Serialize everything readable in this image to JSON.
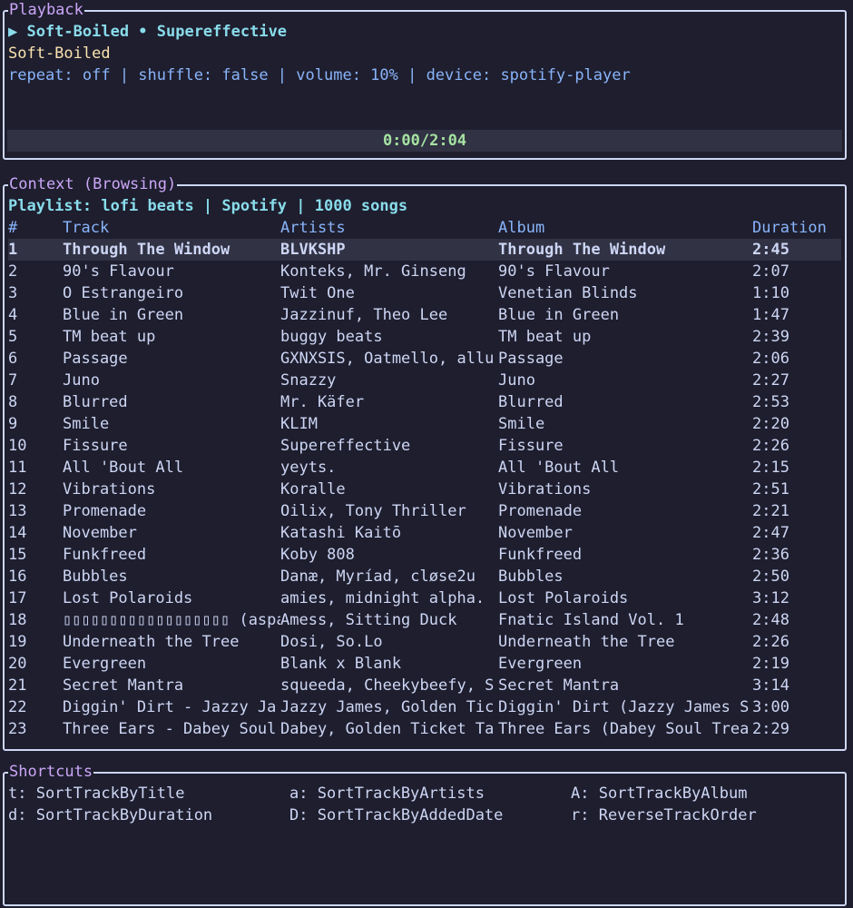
{
  "playback": {
    "title": "Playback",
    "now_playing": "▶ Soft-Boiled • Supereffective",
    "album": "Soft-Boiled",
    "status": "repeat: off | shuffle: false | volume: 10% | device: spotify-player",
    "progress_text": "0:00/2:04"
  },
  "context": {
    "title": "Context (Browsing)",
    "playlist_line": "Playlist: lofi beats | Spotify | 1000 songs",
    "columns": [
      "#",
      "Track",
      "Artists",
      "Album",
      "Duration"
    ],
    "selected_index": 0,
    "rows": [
      [
        "1",
        "Through The Window",
        "BLVKSHP",
        "Through The Window",
        "2:45"
      ],
      [
        "2",
        "90's Flavour",
        "Konteks, Mr. Ginseng",
        "90's Flavour",
        "2:07"
      ],
      [
        "3",
        "O Estrangeiro",
        "Twit One",
        "Venetian Blinds",
        "1:10"
      ],
      [
        "4",
        "Blue in Green",
        "Jazzinuf, Theo Lee",
        "Blue in Green",
        "1:47"
      ],
      [
        "5",
        "TM beat up",
        "buggy beats",
        "TM beat up",
        "2:39"
      ],
      [
        "6",
        "Passage",
        "GXNXSIS, Oatmello, allu",
        "Passage",
        "2:06"
      ],
      [
        "7",
        "Juno",
        "Snazzy",
        "Juno",
        "2:27"
      ],
      [
        "8",
        "Blurred",
        "Mr. Käfer",
        "Blurred",
        "2:53"
      ],
      [
        "9",
        "Smile",
        "KLIM",
        "Smile",
        "2:20"
      ],
      [
        "10",
        "Fissure",
        "Supereffective",
        "Fissure",
        "2:26"
      ],
      [
        "11",
        "All 'Bout All",
        "yeyts.",
        "All 'Bout All",
        "2:15"
      ],
      [
        "12",
        "Vibrations",
        "Koralle",
        "Vibrations",
        "2:51"
      ],
      [
        "13",
        "Promenade",
        "Oilix, Tony Thriller",
        "Promenade",
        "2:21"
      ],
      [
        "14",
        "November",
        "Katashi Kaitō",
        "November",
        "2:47"
      ],
      [
        "15",
        "Funkfreed",
        "Koby 808",
        "Funkfreed",
        "2:36"
      ],
      [
        "16",
        "Bubbles",
        "Danæ, Myríad, cløse2u",
        "Bubbles",
        "2:50"
      ],
      [
        "17",
        "Lost Polaroids",
        "amies, midnight alpha.",
        "Lost Polaroids",
        "3:12"
      ],
      [
        "18",
        "▯▯▯▯▯▯▯▯▯▯▯▯▯▯▯▯▯▯ (aspar",
        "Amess, Sitting Duck",
        "Fnatic Island Vol. 1",
        "2:48"
      ],
      [
        "19",
        "Underneath the Tree",
        "Dosi, So.Lo",
        "Underneath the Tree",
        "2:26"
      ],
      [
        "20",
        "Evergreen",
        "Blank x Blank",
        "Evergreen",
        "2:19"
      ],
      [
        "21",
        "Secret Mantra",
        "squeeda, Cheekybeefy, S",
        "Secret Mantra",
        "3:14"
      ],
      [
        "22",
        "Diggin' Dirt - Jazzy Ja",
        "Jazzy James, Golden Tic",
        "Diggin' Dirt (Jazzy James S",
        "3:00"
      ],
      [
        "23",
        "Three Ears - Dabey Soul",
        "Dabey, Golden Ticket Ta",
        "Three Ears (Dabey Soul Trea",
        "2:29"
      ]
    ]
  },
  "shortcuts": {
    "title": "Shortcuts",
    "items": [
      "t: SortTrackByTitle",
      "a: SortTrackByArtists",
      "A: SortTrackByAlbum",
      "d: SortTrackByDuration",
      "D: SortTrackByAddedDate",
      "r: ReverseTrackOrder"
    ]
  },
  "colors": {
    "background": "#1e1e2e",
    "border": "#cdd6f4",
    "panel_title": "#cba6f7",
    "accent_cyan": "#89dceb",
    "header_blue": "#89b4fa",
    "album_yellow": "#f9e2af",
    "progress_green": "#a6e3a1",
    "selection_bg": "#313244"
  }
}
